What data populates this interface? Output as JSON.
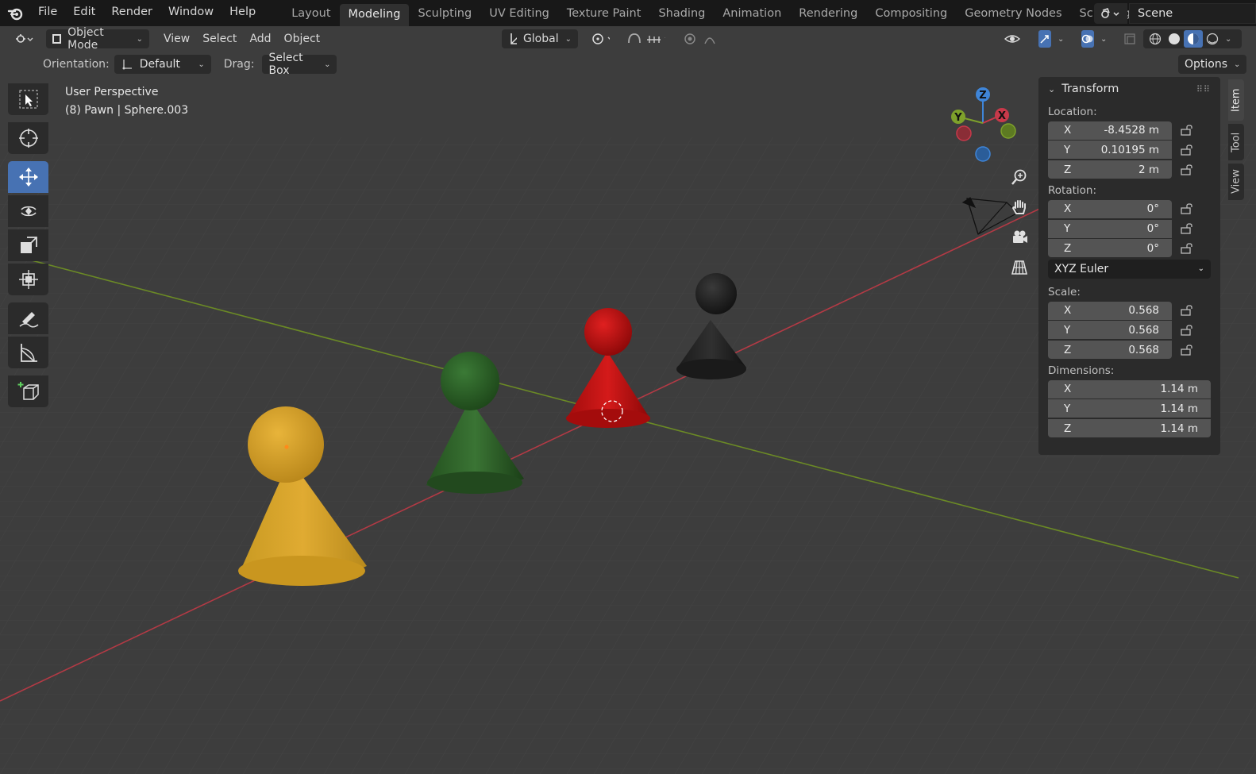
{
  "menu": {
    "file": "File",
    "edit": "Edit",
    "render": "Render",
    "window": "Window",
    "help": "Help"
  },
  "workspaces": [
    "Layout",
    "Modeling",
    "Sculpting",
    "UV Editing",
    "Texture Paint",
    "Shading",
    "Animation",
    "Rendering",
    "Compositing",
    "Geometry Nodes",
    "Scripting"
  ],
  "scene": {
    "name": "Scene"
  },
  "header": {
    "mode": "Object Mode",
    "view": "View",
    "select": "Select",
    "add": "Add",
    "object": "Object",
    "transform_orientation": "Global",
    "options": "Options"
  },
  "tool_settings": {
    "orientation_label": "Orientation:",
    "orientation_value": "Default",
    "drag_label": "Drag:",
    "drag_value": "Select Box"
  },
  "viewport_info": {
    "line1": "User Perspective",
    "line2": "(8) Pawn | Sphere.003"
  },
  "gizmo": {
    "x": "X",
    "y": "Y",
    "z": "Z"
  },
  "transform": {
    "title": "Transform",
    "location_label": "Location:",
    "location": {
      "x": "-8.4528 m",
      "y": "0.10195 m",
      "z": "2 m"
    },
    "rotation_label": "Rotation:",
    "rotation": {
      "x": "0°",
      "y": "0°",
      "z": "0°"
    },
    "rotation_mode": "XYZ Euler",
    "scale_label": "Scale:",
    "scale": {
      "x": "0.568",
      "y": "0.568",
      "z": "0.568"
    },
    "dimensions_label": "Dimensions:",
    "dimensions": {
      "x": "1.14 m",
      "y": "1.14 m",
      "z": "1.14 m"
    },
    "axis": {
      "x": "X",
      "y": "Y",
      "z": "Z"
    }
  },
  "sidebar_tabs": {
    "item": "Item",
    "tool": "Tool",
    "view": "View"
  },
  "colors": {
    "accent": "#4772b3",
    "yellow_pawn": "#d9a52a",
    "green_pawn": "#2e5a2a",
    "red_pawn": "#b81010",
    "black_pawn": "#1a1a1a",
    "x_axis": "#c8394a",
    "y_axis": "#7ea12b",
    "z_axis": "#3f85d8"
  }
}
